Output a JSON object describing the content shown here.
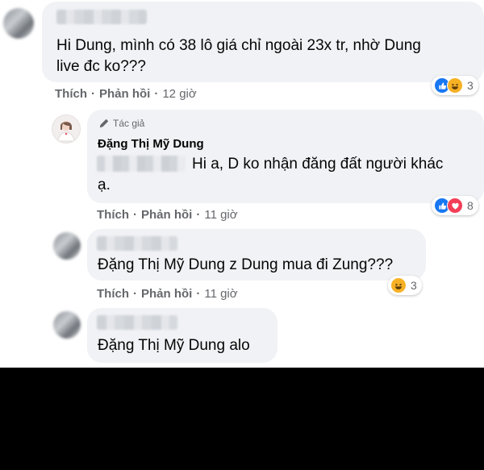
{
  "comments": [
    {
      "text_lines": [
        "Hi Dung, mình có 38 lô giá chỉ ngoài 23x tr, nhờ Dung",
        "live đc ko???"
      ],
      "actions": {
        "like": "Thích",
        "reply": "Phản hồi",
        "time": "12 giờ"
      },
      "reactions": {
        "icons": [
          "like-icon",
          "haha-icon"
        ],
        "count": "3"
      }
    },
    {
      "author_badge": "Tác giả",
      "author_name": "Đặng Thị Mỹ Dung",
      "text_lines": [
        "Hi a, D ko nhận đăng đất người khác",
        "ạ."
      ],
      "actions": {
        "like": "Thích",
        "reply": "Phản hồi",
        "time": "11 giờ"
      },
      "reactions": {
        "icons": [
          "like-icon",
          "love-icon"
        ],
        "count": "8"
      }
    },
    {
      "text": "Đặng Thị Mỹ Dung z Dung mua đi Zung???",
      "actions": {
        "like": "Thích",
        "reply": "Phản hồi",
        "time": "11 giờ"
      },
      "reactions": {
        "icons": [
          "haha-icon"
        ],
        "count": "3"
      }
    },
    {
      "text": "Đặng Thị Mỹ Dung alo"
    }
  ],
  "colors": {
    "bubble": "#f0f2f5",
    "muted": "#65676b",
    "like": "#1877f2",
    "haha": "#f7b125",
    "love": "#f33e58"
  }
}
